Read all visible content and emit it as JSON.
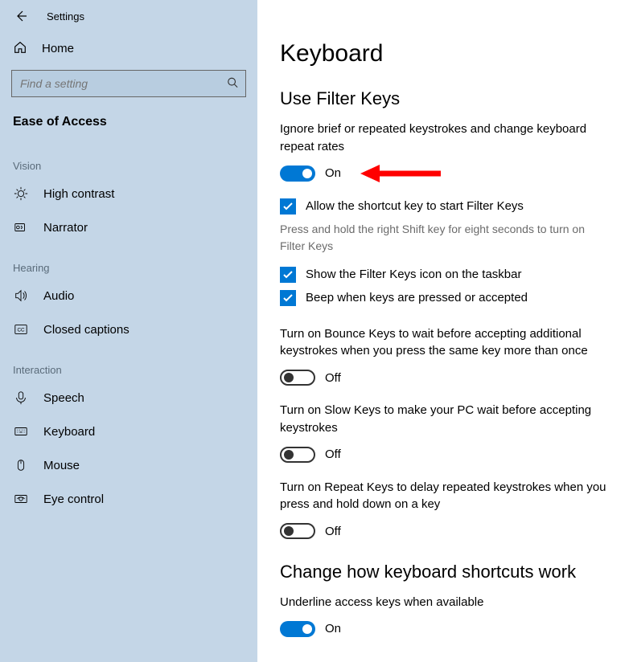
{
  "window": {
    "title": "Settings"
  },
  "sidebar": {
    "home": "Home",
    "search_placeholder": "Find a setting",
    "section": "Ease of Access",
    "groups": [
      {
        "label": "Vision",
        "items": [
          {
            "icon": "brightness",
            "label": "High contrast"
          },
          {
            "icon": "narrator",
            "label": "Narrator"
          }
        ]
      },
      {
        "label": "Hearing",
        "items": [
          {
            "icon": "audio",
            "label": "Audio"
          },
          {
            "icon": "cc",
            "label": "Closed captions"
          }
        ]
      },
      {
        "label": "Interaction",
        "items": [
          {
            "icon": "mic",
            "label": "Speech"
          },
          {
            "icon": "keyboard",
            "label": "Keyboard"
          },
          {
            "icon": "mouse",
            "label": "Mouse"
          },
          {
            "icon": "eye",
            "label": "Eye control"
          }
        ]
      }
    ]
  },
  "main": {
    "title": "Keyboard",
    "section1_title": "Use Filter Keys",
    "filter_desc": "Ignore brief or repeated keystrokes and change keyboard repeat rates",
    "filter_toggle": {
      "state": "on",
      "label": "On"
    },
    "chk_shortcut": "Allow the shortcut key to start Filter Keys",
    "chk_shortcut_hint": "Press and hold the right Shift key for eight seconds to turn on Filter Keys",
    "chk_icon": "Show the Filter Keys icon on the taskbar",
    "chk_beep": "Beep when keys are pressed or accepted",
    "bounce_desc": "Turn on Bounce Keys to wait before accepting additional keystrokes when you press the same key more than once",
    "bounce_toggle": {
      "state": "off",
      "label": "Off"
    },
    "slow_desc": "Turn on Slow Keys to make your PC wait before accepting keystrokes",
    "slow_toggle": {
      "state": "off",
      "label": "Off"
    },
    "repeat_desc": "Turn on Repeat Keys to delay repeated keystrokes when you press and hold down on a key",
    "repeat_toggle": {
      "state": "off",
      "label": "Off"
    },
    "section2_title": "Change how keyboard shortcuts work",
    "underline_desc": "Underline access keys when available",
    "underline_toggle": {
      "state": "on",
      "label": "On"
    }
  },
  "colors": {
    "accent": "#0078d4",
    "arrow": "#ff0000"
  }
}
